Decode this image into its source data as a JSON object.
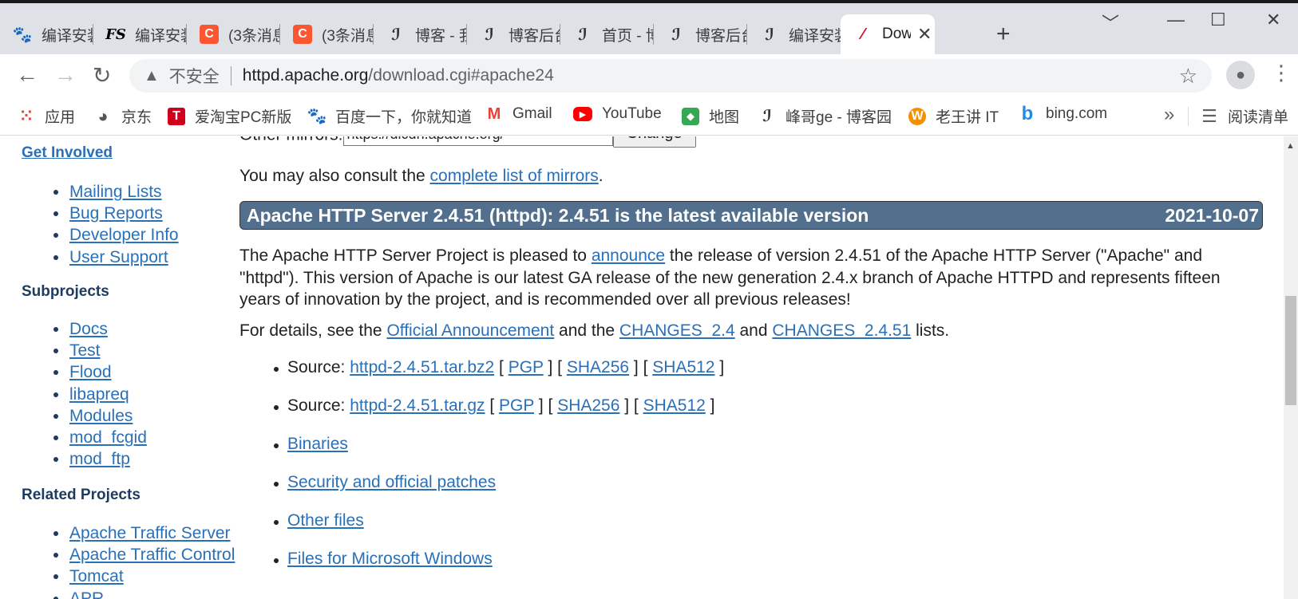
{
  "tabs": [
    {
      "label": "编译安装",
      "icon": "baidu-icon",
      "glyph": "🐾"
    },
    {
      "label": "编译安装",
      "icon": "fs-icon",
      "glyph": "FS"
    },
    {
      "label": "(3条消息",
      "icon": "csdn-icon",
      "glyph": "C"
    },
    {
      "label": "(3条消息",
      "icon": "csdn-icon",
      "glyph": "C"
    },
    {
      "label": "博客 - 我",
      "icon": "cnblogs-icon",
      "glyph": "ℐ"
    },
    {
      "label": "博客后台",
      "icon": "cnblogs-icon",
      "glyph": "ℐ"
    },
    {
      "label": "首页 - 博",
      "icon": "cnblogs-icon",
      "glyph": "ℐ"
    },
    {
      "label": "博客后台",
      "icon": "cnblogs-icon",
      "glyph": "ℐ"
    },
    {
      "label": "编译安装",
      "icon": "cnblogs-icon",
      "glyph": "ℐ"
    },
    {
      "label": "Dow",
      "icon": "apache-feather-icon",
      "glyph": "⁄",
      "active": true
    }
  ],
  "window": {
    "minimize": "﹀",
    "restore": "—",
    "maximize": "☐",
    "close": "✕",
    "new_tab": "+",
    "tab_close": "✕"
  },
  "toolbar": {
    "back": "←",
    "forward": "→",
    "reload": "↻",
    "security_icon": "▲",
    "security_text": "不安全",
    "url_host": "httpd.apache.org",
    "url_path": "/download.cgi#apache24",
    "star": "☆",
    "profile": "●",
    "menu": "⋮"
  },
  "bookmarks": {
    "items": [
      {
        "label": "应用",
        "icon": "apps-icon",
        "glyph": "⁙"
      },
      {
        "label": "京东",
        "icon": "jd-icon",
        "glyph": "◕"
      },
      {
        "label": "爱淘宝PC新版",
        "icon": "taobao-icon",
        "glyph": "T"
      },
      {
        "label": "百度一下，你就知道",
        "icon": "baidu-icon",
        "glyph": "🐾"
      },
      {
        "label": "Gmail",
        "icon": "gmail-icon",
        "glyph": "M"
      },
      {
        "label": "YouTube",
        "icon": "youtube-icon",
        "glyph": "▶"
      },
      {
        "label": "地图",
        "icon": "maps-icon",
        "glyph": "◆"
      },
      {
        "label": "峰哥ge - 博客园",
        "icon": "cnblogs-icon",
        "glyph": "ℐ"
      },
      {
        "label": "老王讲 IT",
        "icon": "laowang-icon",
        "glyph": "W"
      },
      {
        "label": "bing.com",
        "icon": "bing-icon",
        "glyph": "b"
      }
    ],
    "more": "»",
    "reading_list": "阅读清单",
    "reading_glyph": "☰"
  },
  "sidebar": {
    "get_involved": "Get Involved",
    "get_involved_items": [
      "Mailing Lists",
      "Bug Reports",
      "Developer Info",
      "User Support"
    ],
    "subprojects_title": "Subprojects",
    "subprojects": [
      "Docs",
      "Test",
      "Flood",
      "libapreq",
      "Modules",
      "mod_fcgid",
      "mod_ftp"
    ],
    "related_title": "Related Projects",
    "related": [
      "Apache Traffic Server",
      "Apache Traffic Control",
      "Tomcat",
      "APR"
    ]
  },
  "main": {
    "mirror_label": "Other mirrors:",
    "mirror_value": "https://dlcdn.apache.org/",
    "change_button": "Change",
    "consult_prefix": "You may also consult the ",
    "consult_link": "complete list of mirrors",
    "consult_suffix": ".",
    "banner_title": "Apache HTTP Server 2.4.51 (httpd): 2.4.51 is the latest available version",
    "banner_date": "2021-10-07",
    "intro_1": "The Apache HTTP Server Project is pleased to ",
    "intro_link": "announce",
    "intro_2": " the release of version 2.4.51 of the Apache HTTP Server (\"Apache\" and",
    "intro_3": "\"httpd\"). This version of Apache is our latest GA release of the new generation 2.4.x branch of Apache HTTPD and represents fifteen",
    "intro_4": "years of innovation by the project, and is recommended over all previous releases!",
    "details_prefix": "For details, see the ",
    "details_link1": "Official Announcement",
    "details_and1": " and the ",
    "details_link2": "CHANGES_2.4",
    "details_and2": " and ",
    "details_link3": "CHANGES_2.4.51",
    "details_suffix": " lists.",
    "source_label": "Source: ",
    "source_bz2": "httpd-2.4.51.tar.bz2",
    "source_gz": "httpd-2.4.51.tar.gz",
    "pgp": "PGP",
    "sha256": "SHA256",
    "sha512": "SHA512",
    "links": [
      "Binaries",
      "Security and official patches",
      "Other files",
      "Files for Microsoft Windows"
    ]
  },
  "scrollbar": {
    "up": "▲"
  }
}
